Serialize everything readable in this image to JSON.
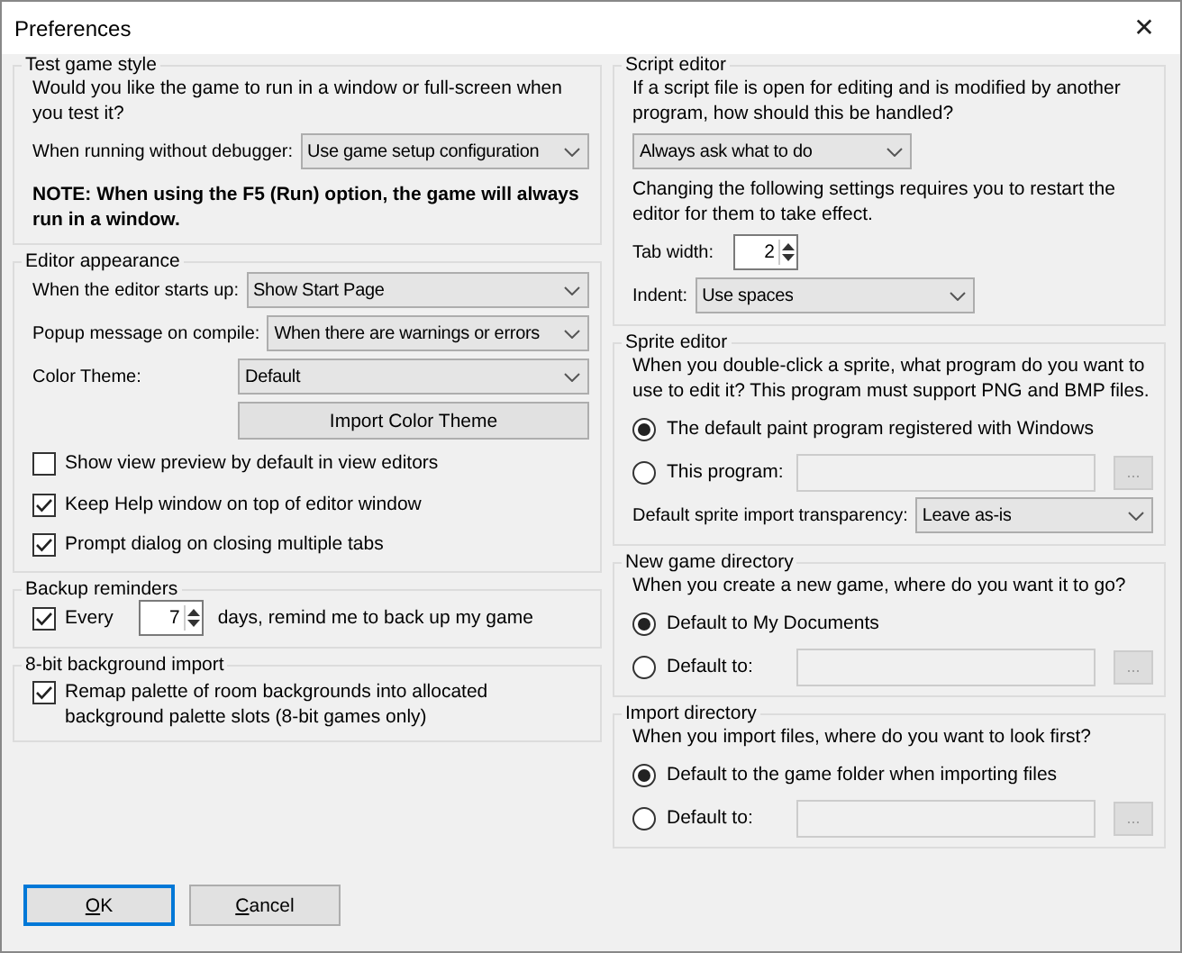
{
  "window": {
    "title": "Preferences",
    "close": "✕"
  },
  "left_groups": [
    {
      "title": "Test game style",
      "rows": [
        {
          "kind": "text",
          "text": "Would you like the game to run in a window or full-screen when you test it?"
        },
        {
          "kind": "select",
          "label": "When running without debugger:",
          "value": "Use game setup configuration"
        },
        {
          "kind": "note",
          "text": "NOTE: When using the F5 (Run) option, the game will always run in a window."
        }
      ]
    },
    {
      "title": "Editor appearance",
      "rows": [
        {
          "kind": "select",
          "label": "When the editor starts up:",
          "value": "Show Start Page"
        },
        {
          "kind": "select",
          "label": "Popup message on compile:",
          "value": "When there are warnings or errors"
        },
        {
          "kind": "select",
          "label": "Color Theme:",
          "value": "Default"
        },
        {
          "kind": "button",
          "label": "Import Color Theme"
        },
        {
          "kind": "checkbox",
          "label": "Show view preview by default in view editors",
          "checked": false
        },
        {
          "kind": "checkbox",
          "label": "Keep Help window on top of editor window",
          "checked": true
        },
        {
          "kind": "checkbox",
          "label": "Prompt dialog on closing multiple tabs",
          "checked": true
        }
      ]
    },
    {
      "title": "Backup reminders",
      "rows": [
        {
          "kind": "checkbox_spin",
          "label": "Every",
          "checked": true,
          "value": "7",
          "suffix": "days, remind me to back up my game"
        }
      ]
    },
    {
      "title": "8-bit background import",
      "rows": [
        {
          "kind": "checkbox",
          "label": "Remap palette of room backgrounds into allocated background palette slots (8-bit games only)",
          "checked": true
        }
      ]
    }
  ],
  "right_groups": [
    {
      "title": "Script editor",
      "rows": [
        {
          "kind": "text",
          "text": "If a script file is open for editing and is modified by another program, how should this be handled?"
        },
        {
          "kind": "select",
          "value": "Always ask what to do"
        },
        {
          "kind": "text",
          "text": "Changing the following settings requires you to restart the editor for them to take effect."
        },
        {
          "kind": "spin",
          "label": "Tab width:",
          "value": "2"
        },
        {
          "kind": "select",
          "label": "Indent:",
          "value": "Use spaces"
        }
      ]
    },
    {
      "title": "Sprite editor",
      "rows": [
        {
          "kind": "text",
          "text": "When you double-click a sprite, what program do you want to use to edit it? This program must support PNG and BMP files."
        },
        {
          "kind": "radio",
          "label": "The default paint program registered with Windows",
          "selected": true
        },
        {
          "kind": "radio_path",
          "label": "This program:",
          "selected": false,
          "disabled": true,
          "browse": "..."
        },
        {
          "kind": "select",
          "label": "Default sprite import transparency:",
          "value": "Leave as-is"
        }
      ]
    },
    {
      "title": "New game directory",
      "rows": [
        {
          "kind": "text",
          "text": "When you create a new game, where do you want it to go?"
        },
        {
          "kind": "radio",
          "label": "Default to My Documents",
          "selected": true
        },
        {
          "kind": "radio_path",
          "label": "Default to:",
          "selected": false,
          "disabled": true,
          "browse": "..."
        }
      ]
    },
    {
      "title": "Import directory",
      "rows": [
        {
          "kind": "text",
          "text": "When you import files, where do you want to look first?"
        },
        {
          "kind": "radio",
          "label": "Default to the game folder when importing files",
          "selected": true
        },
        {
          "kind": "radio_path",
          "label": "Default to:",
          "selected": false,
          "disabled": true,
          "browse": "..."
        }
      ]
    }
  ],
  "buttons": [
    {
      "label": "OK",
      "default": true
    },
    {
      "label": "Cancel",
      "default": false
    }
  ]
}
